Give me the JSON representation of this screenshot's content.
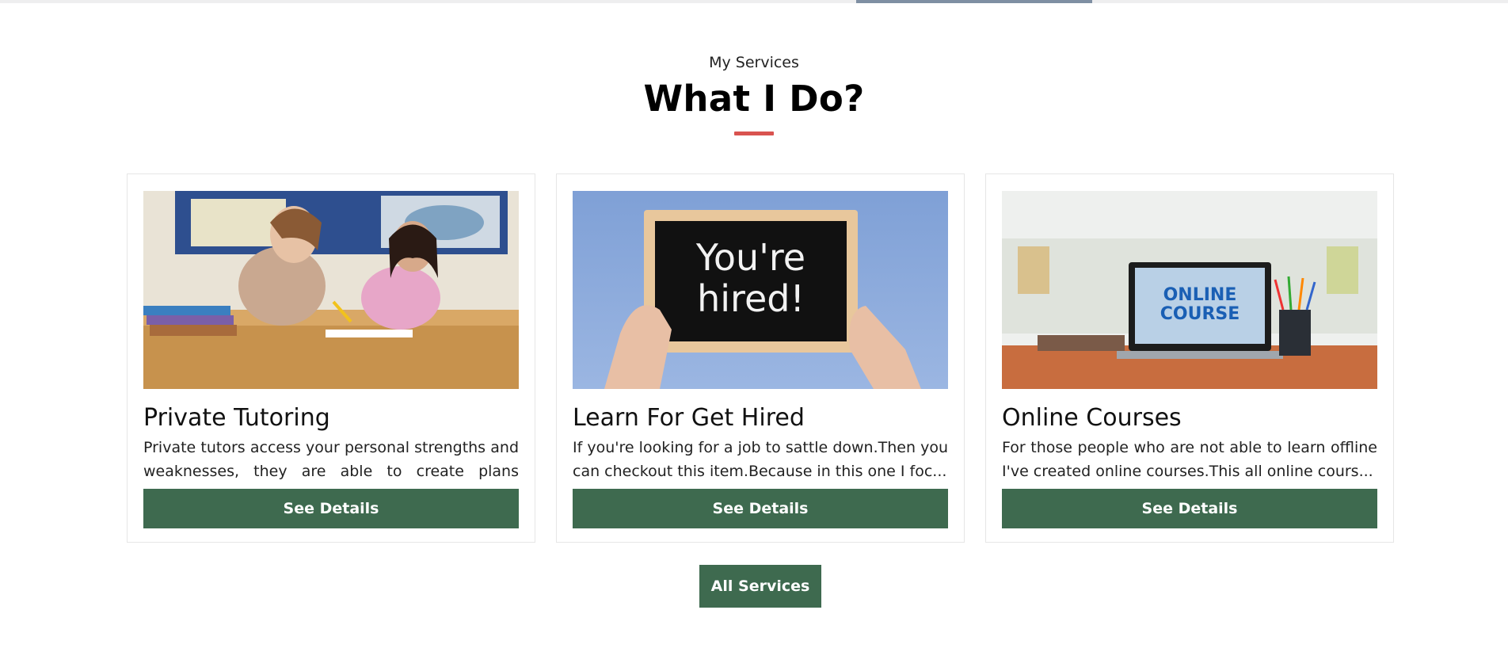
{
  "section": {
    "eyebrow": "My Services",
    "title": "What I Do?",
    "accent_color": "#d9534f"
  },
  "services": [
    {
      "title": "Private Tutoring",
      "description": "Private tutors access your personal strengths and weaknesses, they are able to create plans tailored...",
      "button_label": "See Details",
      "image": "teacher-and-student-photo"
    },
    {
      "title": "Learn For Get Hired",
      "description": "If you're looking for a job to sattle down.Then you can checkout this item.Because in this one I foc...",
      "button_label": "See Details",
      "image": "youre-hired-chalkboard-photo",
      "image_text": [
        "You're",
        "hired!"
      ]
    },
    {
      "title": "Online Courses",
      "description": "For those people who are not able to learn offline I've created online courses.This all online cours...",
      "button_label": "See Details",
      "image": "online-course-laptop-photo",
      "image_text": [
        "ONLINE",
        "COURSE"
      ]
    }
  ],
  "all_services_label": "All Services",
  "button_color": "#3e6a4f"
}
